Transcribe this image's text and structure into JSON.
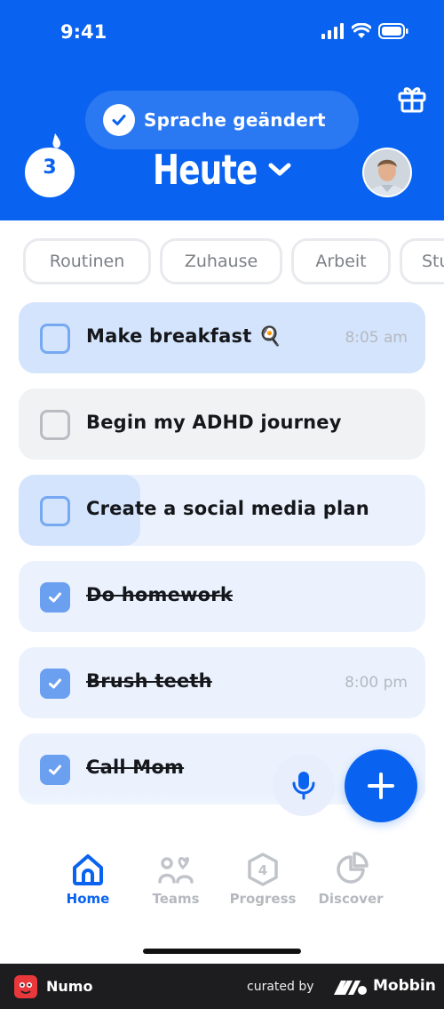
{
  "status_bar": {
    "time": "9:41"
  },
  "header": {
    "toast_text": "Sprache geändert",
    "streak_count": "3",
    "title": "Heute",
    "colors": {
      "brand_blue": "#0a63f0",
      "toast_bg": "#2b78f3"
    }
  },
  "categories": [
    "Routinen",
    "Zuhause",
    "Arbeit",
    "Stu"
  ],
  "tasks": [
    {
      "label": "Make breakfast 🍳",
      "time": "8:05 am",
      "done": false,
      "progress": 1.0
    },
    {
      "label": "Begin my ADHD journey",
      "time": "",
      "done": false,
      "progress": 0
    },
    {
      "label": "Create a social media plan",
      "time": "",
      "done": false,
      "progress": 0.3
    },
    {
      "label": "Do homework",
      "time": "",
      "done": true,
      "progress": 0
    },
    {
      "label": "Brush teeth",
      "time": "8:00 pm",
      "done": true,
      "progress": 0
    },
    {
      "label": "Call Mom",
      "time": "",
      "done": true,
      "progress": 0
    }
  ],
  "actions": {
    "mic_icon": "microphone-icon",
    "add_icon": "plus-icon"
  },
  "tabs": [
    {
      "label": "Home",
      "icon": "home-icon",
      "active": true
    },
    {
      "label": "Teams",
      "icon": "teams-icon",
      "active": false
    },
    {
      "label": "Progress",
      "icon": "progress-icon",
      "active": false,
      "badge": "4"
    },
    {
      "label": "Discover",
      "icon": "discover-icon",
      "active": false
    }
  ],
  "footer": {
    "app_name": "Numo",
    "curated_by": "curated by",
    "brand": "Mobbin"
  }
}
